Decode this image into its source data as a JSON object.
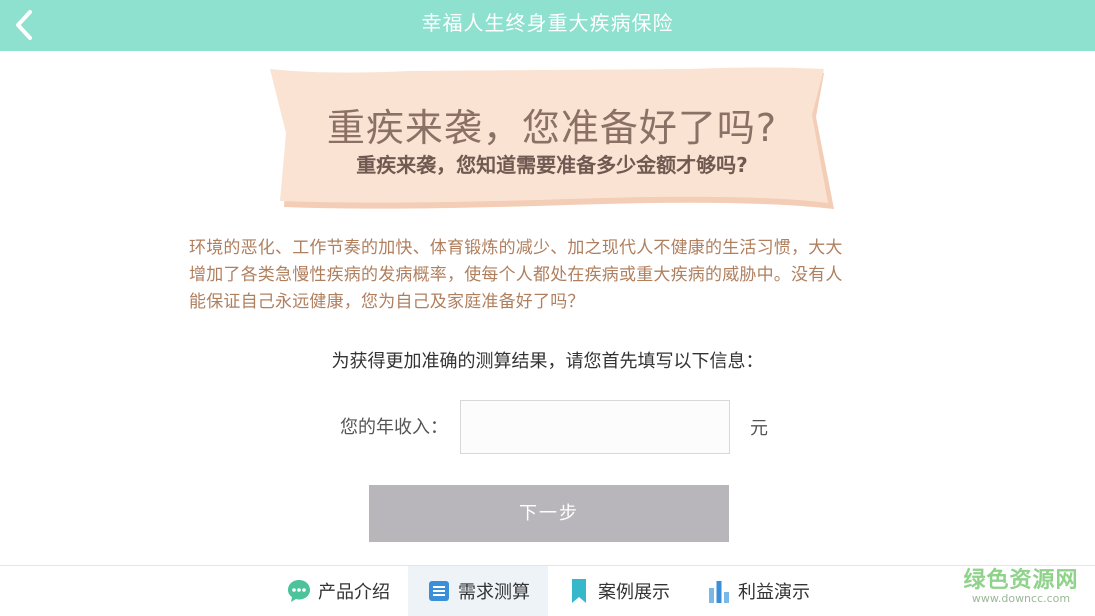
{
  "header": {
    "title": "幸福人生终身重大疾病保险",
    "back_icon": "chevron-left-icon"
  },
  "banner": {
    "title": "重疾来袭，您准备好了吗?",
    "subtitle": "重疾来袭，您知道需要准备多少金额才够吗?"
  },
  "intro": {
    "lines": [
      "环境的恶化、工作节奏的加快、体育锻炼的减少、加之现代人不健康的生活习惯，大大",
      "增加了各类急慢性疾病的发病概率，使每个人都处在疾病或重大疾病的威胁中。没有人",
      "能保证自己永远健康，您为自己及家庭准备好了吗？"
    ]
  },
  "form": {
    "prompt": "为获得更加准确的测算结果，请您首先填写以下信息：",
    "income_label": "您的年收入：",
    "income_value": "",
    "income_placeholder": "",
    "unit": "元",
    "next_label": "下一步"
  },
  "tabs": [
    {
      "label": "产品介绍",
      "icon": "chat-bubble-icon",
      "active": false
    },
    {
      "label": "需求测算",
      "icon": "list-icon",
      "active": true
    },
    {
      "label": "案例展示",
      "icon": "bookmark-icon",
      "active": false
    },
    {
      "label": "利益演示",
      "icon": "bar-chart-icon",
      "active": false
    }
  ],
  "watermark": {
    "main": "绿色资源网",
    "sub": "www.downcc.com"
  },
  "colors": {
    "header_bg": "#8ee0cf",
    "banner_bg": "#fbe3d3",
    "intro_text": "#b07f5e",
    "button_bg": "#b9b6bb",
    "tab_icon_green": "#4cc39a",
    "tab_icon_blue": "#3b8fd9",
    "tab_icon_teal": "#35b8c9"
  }
}
